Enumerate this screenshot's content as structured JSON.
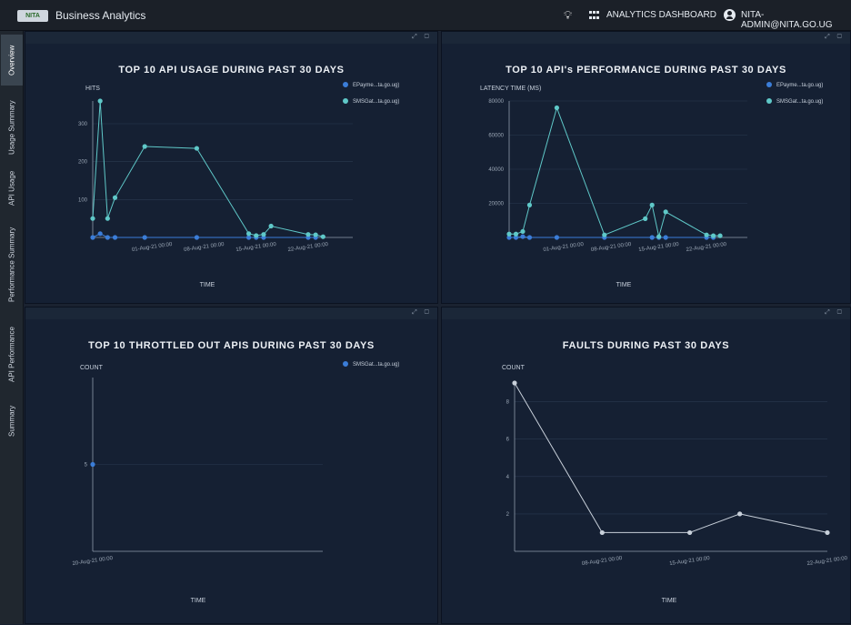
{
  "header": {
    "logo_text": "NITA",
    "app_title": "Business Analytics",
    "dashboard_label": "ANALYTICS DASHBOARD",
    "user_label": "NITA-ADMIN@NITA.GO.UG"
  },
  "sidebar": {
    "items": [
      {
        "label": "Overview",
        "active": true
      },
      {
        "label": "Usage Summary",
        "active": false
      },
      {
        "label": "API Usage",
        "active": false
      },
      {
        "label": "Performance Summary",
        "active": false
      },
      {
        "label": "API Performance",
        "active": false
      },
      {
        "label": "Summary",
        "active": false
      }
    ]
  },
  "panels": {
    "controls": "⤢ ▢",
    "usage": {
      "title": "TOP 10 API USAGE DURING PAST 30 DAYS"
    },
    "performance": {
      "title": "TOP 10 API's PERFORMANCE DURING PAST 30 DAYS"
    },
    "throttled": {
      "title": "TOP 10 THROTTLED OUT APIS DURING PAST 30 DAYS"
    },
    "faults": {
      "title": "FAULTS DURING PAST 30 DAYS"
    }
  },
  "colors": {
    "series_a": "#3b7dd8",
    "series_b": "#5fc8c8",
    "faults_line": "#c8d0da",
    "grid": "#2a3950",
    "axis": "#8e9bab"
  },
  "chart_data": [
    {
      "id": "usage",
      "type": "line",
      "title": "TOP 10 API USAGE DURING PAST 30 DAYS",
      "ylabel": "HITS",
      "xlabel": "TIME",
      "ylim": [
        0,
        360
      ],
      "xlim": [
        -3,
        32
      ],
      "yticks": [
        100,
        200,
        300
      ],
      "xticks": [
        {
          "x": 5,
          "label": "01-Aug-21 00:00"
        },
        {
          "x": 12,
          "label": "08-Aug-21 00:00"
        },
        {
          "x": 19,
          "label": "15-Aug-21 00:00"
        },
        {
          "x": 26,
          "label": "22-Aug-21 00:00"
        }
      ],
      "legend": "top-right",
      "series": [
        {
          "name": "EPayme...ta.go.ug)",
          "color_key": "series_a",
          "x": [
            -3,
            -2,
            -1,
            0,
            4,
            11,
            18,
            19,
            20,
            26,
            27
          ],
          "y": [
            0,
            10,
            0,
            0,
            0,
            0,
            0,
            0,
            0,
            0,
            0
          ]
        },
        {
          "name": "SMSGat...ta.go.ug)",
          "color_key": "series_b",
          "x": [
            -3,
            -2,
            -1,
            0,
            4,
            11,
            18,
            19,
            20,
            21,
            26,
            27,
            28
          ],
          "y": [
            50,
            360,
            50,
            105,
            240,
            235,
            10,
            5,
            8,
            30,
            8,
            7,
            2
          ]
        }
      ]
    },
    {
      "id": "performance",
      "type": "line",
      "title": "TOP 10 API's PERFORMANCE DURING PAST 30 DAYS",
      "ylabel": "LATENCY TIME (MS)",
      "xlabel": "TIME",
      "ylim": [
        0,
        80000
      ],
      "xlim": [
        -3,
        32
      ],
      "yticks": [
        20000,
        40000,
        60000,
        80000
      ],
      "xticks": [
        {
          "x": 5,
          "label": "01-Aug-21 00:00"
        },
        {
          "x": 12,
          "label": "08-Aug-21 00:00"
        },
        {
          "x": 19,
          "label": "15-Aug-21 00:00"
        },
        {
          "x": 26,
          "label": "22-Aug-21 00:00"
        }
      ],
      "legend": "top-right",
      "series": [
        {
          "name": "EPayme...ta.go.ug)",
          "color_key": "series_a",
          "x": [
            -3,
            -2,
            -1,
            0,
            4,
            11,
            18,
            19,
            20,
            26,
            27
          ],
          "y": [
            0,
            0,
            500,
            0,
            0,
            0,
            0,
            0,
            0,
            0,
            0
          ]
        },
        {
          "name": "SMSGat...ta.go.ug)",
          "color_key": "series_b",
          "x": [
            -3,
            -2,
            -1,
            0,
            4,
            11,
            17,
            18,
            19,
            20,
            26,
            27,
            28
          ],
          "y": [
            2000,
            2000,
            3500,
            19000,
            76000,
            1500,
            11000,
            19000,
            500,
            15000,
            1500,
            1000,
            1000
          ]
        }
      ]
    },
    {
      "id": "throttled",
      "type": "line",
      "title": "TOP 10 THROTTLED OUT APIS DURING PAST 30 DAYS",
      "ylabel": "COUNT",
      "xlabel": "TIME",
      "ylim": [
        0,
        10
      ],
      "xlim": [
        0,
        10
      ],
      "yticks": [
        5
      ],
      "xticks": [
        {
          "x": 0,
          "label": "20-Aug-21 00:00"
        }
      ],
      "legend": "top-right",
      "series": [
        {
          "name": "SMSGat...ta.go.ug)",
          "color_key": "series_a",
          "x": [
            0
          ],
          "y": [
            5
          ]
        }
      ]
    },
    {
      "id": "faults",
      "type": "line",
      "title": "FAULTS DURING PAST 30 DAYS",
      "ylabel": "COUNT",
      "xlabel": "TIME",
      "ylim": [
        0,
        9
      ],
      "xlim": [
        0,
        25
      ],
      "yticks": [
        2,
        4,
        6,
        8
      ],
      "xticks": [
        {
          "x": 7,
          "label": "08-Aug-21 00:00"
        },
        {
          "x": 14,
          "label": "15-Aug-21 00:00"
        },
        {
          "x": 25,
          "label": "22-Aug-21 00:00"
        }
      ],
      "legend": "none",
      "series": [
        {
          "name": "",
          "color_key": "faults_line",
          "x": [
            0,
            7,
            14,
            18,
            25
          ],
          "y": [
            9,
            1,
            1,
            2,
            1
          ]
        }
      ]
    }
  ]
}
